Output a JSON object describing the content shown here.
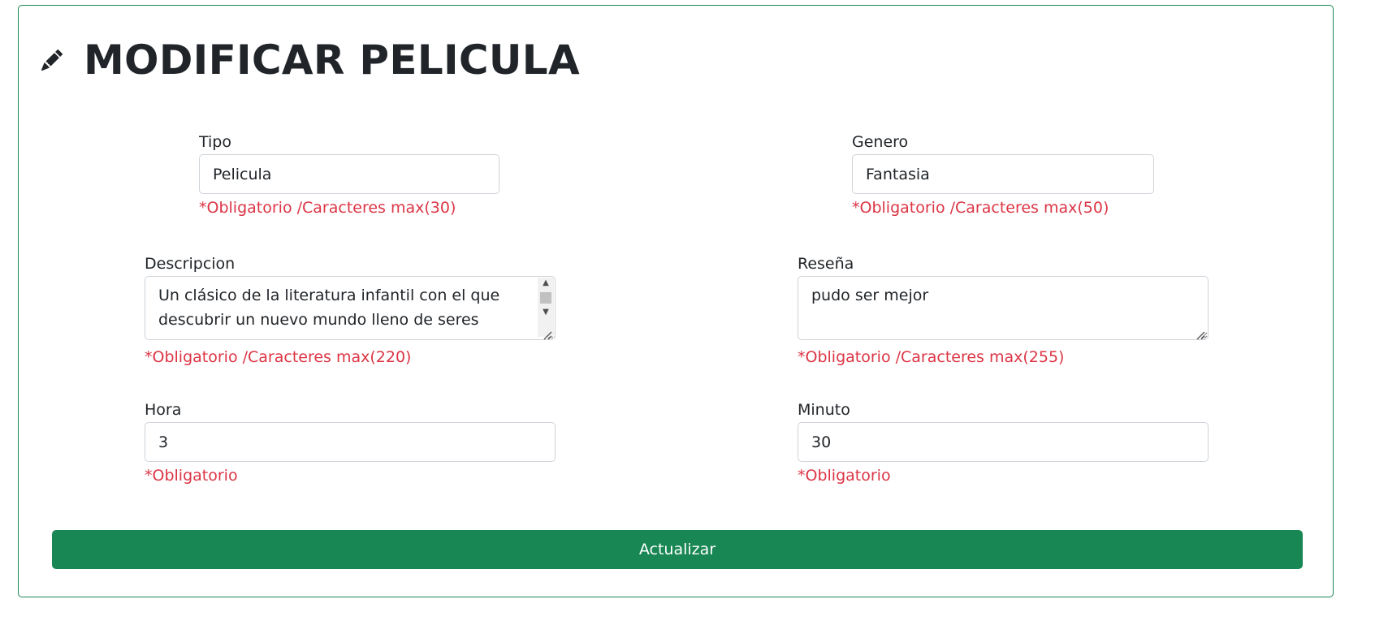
{
  "header": {
    "icon": "pencil-icon",
    "title": "MODIFICAR PELICULA"
  },
  "form": {
    "tipo": {
      "label": "Tipo",
      "value": "Pelicula",
      "hint": "*Obligatorio /Caracteres max(30)"
    },
    "genero": {
      "label": "Genero",
      "value": "Fantasia",
      "hint": "*Obligatorio /Caracteres max(50)"
    },
    "descripcion": {
      "label": "Descripcion",
      "value": "Un clásico de la literatura infantil con el que descubrir un nuevo mundo lleno de seres",
      "hint": "*Obligatorio /Caracteres max(220)"
    },
    "resena": {
      "label": "Reseña",
      "value": "pudo ser mejor",
      "hint": "*Obligatorio /Caracteres max(255)"
    },
    "hora": {
      "label": "Hora",
      "value": "3",
      "hint": "*Obligatorio"
    },
    "minuto": {
      "label": "Minuto",
      "value": "30",
      "hint": "*Obligatorio"
    },
    "submit_label": "Actualizar"
  },
  "colors": {
    "accent": "#198754",
    "error": "#dc3545",
    "text": "#212529"
  }
}
